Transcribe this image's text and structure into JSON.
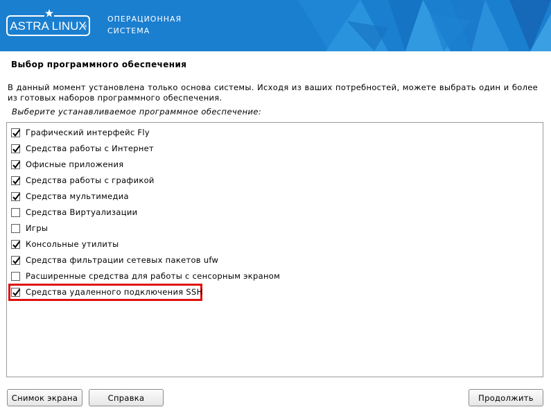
{
  "header": {
    "logo_text": "ASTRA LINUX",
    "logo_reg": "®",
    "os_line1": "ОПЕРАЦИОННАЯ",
    "os_line2": "СИСТЕМА",
    "brand_color": "#1b7fd0"
  },
  "page": {
    "title": "Выбор программного обеспечения",
    "description": "В данный момент установлена только основа системы. Исходя из ваших потребностей, можете выбрать один и более из готовых наборов программного обеспечения.",
    "prompt": "Выберите устанавливаемое программное обеспечение:"
  },
  "software_list": {
    "items": [
      {
        "label": "Графический интерфейс Fly",
        "checked": true
      },
      {
        "label": "Средства работы с Интернет",
        "checked": true
      },
      {
        "label": "Офисные приложения",
        "checked": true
      },
      {
        "label": "Средства работы с графикой",
        "checked": true
      },
      {
        "label": "Средства мультимедиа",
        "checked": true
      },
      {
        "label": "Средства Виртуализации",
        "checked": false
      },
      {
        "label": "Игры",
        "checked": false
      },
      {
        "label": "Консольные утилиты",
        "checked": true
      },
      {
        "label": "Средства фильтрации сетевых пакетов ufw",
        "checked": true
      },
      {
        "label": "Расширенные средства для работы с сенсорным экраном",
        "checked": false
      },
      {
        "label": "Средства удаленного подключения SSH",
        "checked": true
      }
    ],
    "highlight_color": "#e01010"
  },
  "buttons": {
    "screenshot": "Снимок экрана",
    "help": "Справка",
    "continue": "Продолжить"
  }
}
